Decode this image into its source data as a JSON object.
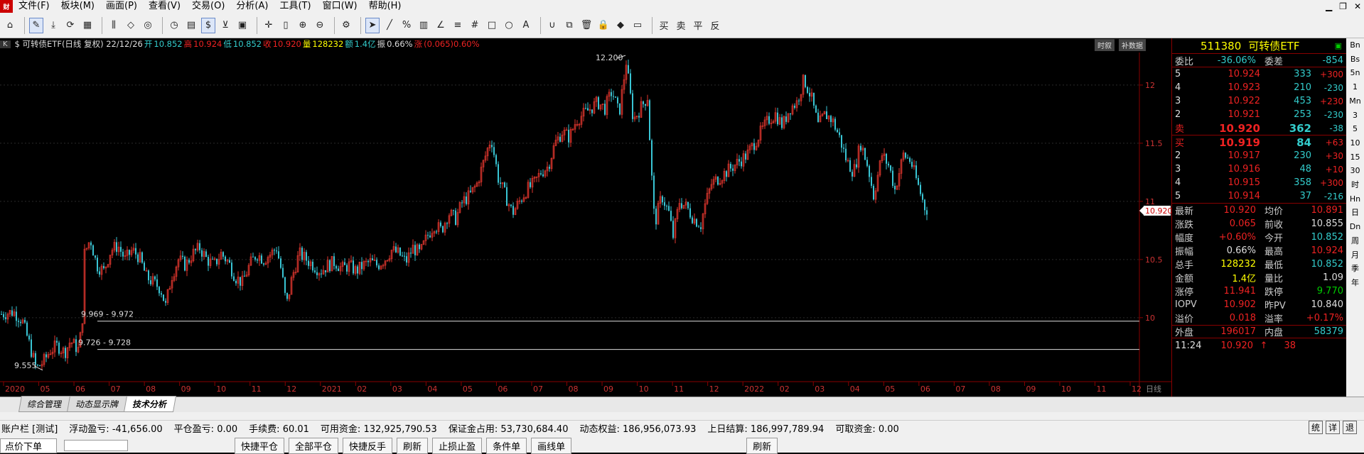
{
  "menu": {
    "logo": "财",
    "items": [
      "文件(F)",
      "板块(M)",
      "画面(P)",
      "查看(V)",
      "交易(O)",
      "分析(A)",
      "工具(T)",
      "窗口(W)",
      "帮助(H)"
    ]
  },
  "toolbar_icons": [
    "home-icon",
    "draw-pen-icon",
    "download-icon",
    "refresh-icon",
    "grid-icon",
    "vertical-bar-icon",
    "diamond-icon",
    "target-icon",
    "clock-icon",
    "notepad-icon",
    "dollar-icon",
    "filter-icon",
    "calculator-icon",
    "crosshair-icon",
    "ruler-icon",
    "zoom-in-icon",
    "zoom-out-icon",
    "gear-icon",
    "cursor-icon",
    "line-tool-icon",
    "percent-icon",
    "rect-tool-icon",
    "angle-tool-icon",
    "channel-icon",
    "grid-tool-icon",
    "square-tool-icon",
    "circle-tool-icon",
    "text-tool-icon",
    "magnet-icon",
    "copy-icon",
    "trash-icon",
    "lock-icon",
    "color-icon",
    "save-icon"
  ],
  "toolbar_text": [
    "买",
    "卖",
    "平",
    "反"
  ],
  "info": {
    "k": "K",
    "name": "$ 可转债ETF(日线 复权) 22/12/26",
    "open_l": "开",
    "open": "10.852",
    "high_l": "高",
    "high": "10.924",
    "low_l": "低",
    "low": "10.852",
    "close_l": "收",
    "close": "10.920",
    "vol_l": "量",
    "vol": "128232",
    "amt_l": "额",
    "amt": "1.4亿",
    "amp_l": "振",
    "amp": "0.66%",
    "chg_l": "涨",
    "chg": "(0.065)0.60%"
  },
  "chart_buttons": [
    "时叙",
    "补数据"
  ],
  "chart_data": {
    "type": "candlestick",
    "ylim": [
      9.45,
      12.28
    ],
    "yticks": [
      10.0,
      10.5,
      11.0,
      11.5,
      12.0
    ],
    "xticks": [
      "2020",
      "05",
      "06",
      "07",
      "08",
      "09",
      "10",
      "11",
      "12",
      "2021",
      "02",
      "03",
      "04",
      "05",
      "06",
      "07",
      "08",
      "09",
      "10",
      "11",
      "12",
      "2022",
      "02",
      "03",
      "04",
      "05",
      "06",
      "07",
      "08",
      "09",
      "10",
      "11",
      "12"
    ],
    "x_axis_label": "日线",
    "last_price": "10.920",
    "annotations": [
      {
        "text": "12.200"
      },
      {
        "text": "9.555"
      },
      {
        "text": "9.969 - 9.972"
      },
      {
        "text": "9.726 - 9.728"
      }
    ],
    "levels": [
      9.97,
      9.727
    ],
    "path": [
      [
        0,
        10.03
      ],
      [
        18,
        10.05
      ],
      [
        30,
        9.98
      ],
      [
        40,
        9.78
      ],
      [
        50,
        9.56
      ],
      [
        60,
        9.62
      ],
      [
        70,
        9.72
      ],
      [
        80,
        9.76
      ],
      [
        90,
        9.7
      ],
      [
        98,
        9.8
      ],
      [
        110,
        9.72
      ],
      [
        115,
        10.0
      ],
      [
        118,
        10.55
      ],
      [
        126,
        10.68
      ],
      [
        135,
        10.45
      ],
      [
        145,
        10.4
      ],
      [
        155,
        10.58
      ],
      [
        165,
        10.62
      ],
      [
        175,
        10.5
      ],
      [
        185,
        10.58
      ],
      [
        195,
        10.52
      ],
      [
        205,
        10.35
      ],
      [
        215,
        10.3
      ],
      [
        225,
        10.25
      ],
      [
        232,
        10.1
      ],
      [
        240,
        10.35
      ],
      [
        250,
        10.5
      ],
      [
        260,
        10.45
      ],
      [
        270,
        10.55
      ],
      [
        280,
        10.6
      ],
      [
        290,
        10.5
      ],
      [
        300,
        10.45
      ],
      [
        310,
        10.55
      ],
      [
        320,
        10.48
      ],
      [
        330,
        10.35
      ],
      [
        340,
        10.3
      ],
      [
        350,
        10.45
      ],
      [
        360,
        10.55
      ],
      [
        370,
        10.5
      ],
      [
        380,
        10.55
      ],
      [
        388,
        10.6
      ],
      [
        395,
        10.4
      ],
      [
        402,
        10.1
      ],
      [
        410,
        10.35
      ],
      [
        420,
        10.55
      ],
      [
        430,
        10.5
      ],
      [
        440,
        10.45
      ],
      [
        450,
        10.4
      ],
      [
        460,
        10.45
      ],
      [
        470,
        10.48
      ],
      [
        480,
        10.42
      ],
      [
        490,
        10.45
      ],
      [
        500,
        10.4
      ],
      [
        510,
        10.45
      ],
      [
        520,
        10.48
      ],
      [
        530,
        10.45
      ],
      [
        540,
        10.5
      ],
      [
        550,
        10.58
      ],
      [
        560,
        10.55
      ],
      [
        570,
        10.48
      ],
      [
        580,
        10.6
      ],
      [
        590,
        10.55
      ],
      [
        600,
        10.7
      ],
      [
        610,
        10.8
      ],
      [
        620,
        10.75
      ],
      [
        630,
        10.9
      ],
      [
        640,
        10.85
      ],
      [
        650,
        11.0
      ],
      [
        660,
        11.05
      ],
      [
        670,
        11.15
      ],
      [
        680,
        11.35
      ],
      [
        690,
        11.55
      ],
      [
        700,
        11.2
      ],
      [
        710,
        11.05
      ],
      [
        720,
        10.9
      ],
      [
        730,
        11.0
      ],
      [
        740,
        11.1
      ],
      [
        750,
        11.15
      ],
      [
        760,
        11.25
      ],
      [
        770,
        11.3
      ],
      [
        780,
        11.5
      ],
      [
        790,
        11.6
      ],
      [
        800,
        11.55
      ],
      [
        810,
        11.7
      ],
      [
        820,
        11.75
      ],
      [
        830,
        11.8
      ],
      [
        840,
        11.85
      ],
      [
        850,
        11.8
      ],
      [
        860,
        11.95
      ],
      [
        870,
        11.75
      ],
      [
        880,
        12.2
      ],
      [
        890,
        11.7
      ],
      [
        900,
        11.8
      ],
      [
        910,
        11.9
      ],
      [
        916,
        11.2
      ],
      [
        920,
        10.8
      ],
      [
        930,
        11.05
      ],
      [
        940,
        10.9
      ],
      [
        946,
        10.7
      ],
      [
        955,
        11.0
      ],
      [
        965,
        10.95
      ],
      [
        975,
        10.85
      ],
      [
        985,
        10.8
      ],
      [
        990,
        10.95
      ],
      [
        1000,
        11.15
      ],
      [
        1010,
        11.2
      ],
      [
        1020,
        11.25
      ],
      [
        1030,
        11.3
      ],
      [
        1040,
        11.35
      ],
      [
        1050,
        11.4
      ],
      [
        1060,
        11.5
      ],
      [
        1070,
        11.6
      ],
      [
        1080,
        11.7
      ],
      [
        1090,
        11.75
      ],
      [
        1100,
        11.65
      ],
      [
        1110,
        11.8
      ],
      [
        1120,
        11.85
      ],
      [
        1130,
        12.05
      ],
      [
        1140,
        11.9
      ],
      [
        1150,
        11.65
      ],
      [
        1160,
        11.75
      ],
      [
        1170,
        11.7
      ],
      [
        1180,
        11.55
      ],
      [
        1190,
        11.35
      ],
      [
        1200,
        11.25
      ],
      [
        1210,
        11.5
      ],
      [
        1220,
        11.3
      ],
      [
        1228,
        11.05
      ],
      [
        1240,
        11.4
      ],
      [
        1250,
        11.3
      ],
      [
        1258,
        11.1
      ],
      [
        1270,
        11.4
      ],
      [
        1280,
        11.35
      ],
      [
        1290,
        11.15
      ],
      [
        1300,
        10.95
      ],
      [
        1305,
        10.92
      ]
    ]
  },
  "panel": {
    "code": "511380",
    "name": "可转债ETF",
    "weibi_l": "委比",
    "weibi": "-36.06%",
    "weicha_l": "委差",
    "weicha": "-854",
    "asks": [
      {
        "l": "5",
        "p": "10.924",
        "v": "333",
        "d": "+300"
      },
      {
        "l": "4",
        "p": "10.923",
        "v": "210",
        "d": "-230"
      },
      {
        "l": "3",
        "p": "10.922",
        "v": "453",
        "d": "+230"
      },
      {
        "l": "2",
        "p": "10.921",
        "v": "253",
        "d": "-230"
      },
      {
        "l": "卖",
        "p": "10.920",
        "v": "362",
        "d": "-38"
      }
    ],
    "bids": [
      {
        "l": "买",
        "p": "10.919",
        "v": "84",
        "d": "+63"
      },
      {
        "l": "2",
        "p": "10.917",
        "v": "230",
        "d": "+30"
      },
      {
        "l": "3",
        "p": "10.916",
        "v": "48",
        "d": "+10"
      },
      {
        "l": "4",
        "p": "10.915",
        "v": "358",
        "d": "+300"
      },
      {
        "l": "5",
        "p": "10.914",
        "v": "37",
        "d": "-216"
      }
    ],
    "stats": [
      {
        "a": "最新",
        "av": "10.920",
        "ac": "r",
        "b": "均价",
        "bv": "10.891",
        "bc": "r"
      },
      {
        "a": "涨跌",
        "av": "0.065",
        "ac": "r",
        "b": "前收",
        "bv": "10.855",
        "bc": "w"
      },
      {
        "a": "幅度",
        "av": "+0.60%",
        "ac": "r",
        "b": "今开",
        "bv": "10.852",
        "bc": "c"
      },
      {
        "a": "振幅",
        "av": "0.66%",
        "ac": "w",
        "b": "最高",
        "bv": "10.924",
        "bc": "r"
      },
      {
        "a": "总手",
        "av": "128232",
        "ac": "y",
        "b": "最低",
        "bv": "10.852",
        "bc": "c"
      },
      {
        "a": "金额",
        "av": "1.4亿",
        "ac": "y",
        "b": "量比",
        "bv": "1.09",
        "bc": "w"
      },
      {
        "a": "涨停",
        "av": "11.941",
        "ac": "r",
        "b": "跌停",
        "bv": "9.770",
        "bc": "g"
      },
      {
        "a": "IOPV",
        "av": "10.902",
        "ac": "r",
        "b": "昨PV",
        "bv": "10.840",
        "bc": "w"
      },
      {
        "a": "溢价",
        "av": "0.018",
        "ac": "r",
        "b": "溢率",
        "bv": "+0.17%",
        "bc": "r"
      }
    ],
    "outer_l": "外盘",
    "outer": "196017",
    "inner_l": "内盘",
    "inner": "58379",
    "tick_time": "11:24",
    "tick_price": "10.920",
    "tick_arrow": "↑",
    "tick_vol": "38",
    "tabs": [
      "细",
      "势",
      "盘",
      "价",
      "逆",
      "成"
    ]
  },
  "sidebar": [
    "Bn",
    "Bs",
    "5n",
    "1",
    "Mn",
    "3",
    "5",
    "10",
    "15",
    "30",
    "时",
    "Hn",
    "日",
    "Dn",
    "周",
    "月",
    "季",
    "年"
  ],
  "bottom_tabs": [
    "综合管理",
    "动态显示牌",
    "技术分析"
  ],
  "account": {
    "label": "账户栏 [测试]",
    "float_l": "浮动盈亏:",
    "float": "-41,656.00",
    "close_l": "平仓盈亏:",
    "close": "0.00",
    "fee_l": "手续费:",
    "fee": "60.01",
    "avail_l": "可用资金:",
    "avail": "132,925,790.53",
    "margin_l": "保证金占用:",
    "margin": "53,730,684.40",
    "equity_l": "动态权益:",
    "equity": "186,956,073.93",
    "last_l": "上日结算:",
    "last": "186,997,789.94",
    "withdraw_l": "可取资金:",
    "withdraw": "0.00"
  },
  "account_buttons": [
    "统",
    "详",
    "退"
  ],
  "order_bar": {
    "title": "点价下单",
    "buttons": [
      "快捷平仓",
      "全部平仓",
      "快捷反手",
      "刷新",
      "止损止盈",
      "条件单",
      "画线单"
    ],
    "refresh": "刷新"
  }
}
